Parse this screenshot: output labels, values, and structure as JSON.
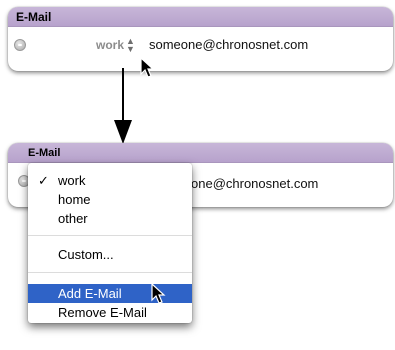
{
  "top_panel": {
    "title": "E-Mail",
    "field_label": "work",
    "field_value": "someone@chronosnet.com"
  },
  "bottom_panel": {
    "title": "E-Mail",
    "field_value_visible": "one@chronosnet.com",
    "field_value_full": "someone@chronosnet.com"
  },
  "menu": {
    "selected": "work",
    "group1": [
      "work",
      "home",
      "other"
    ],
    "custom_label": "Custom...",
    "group3": [
      "Add E-Mail",
      "Remove E-Mail"
    ],
    "highlighted": "Add E-Mail"
  },
  "colors": {
    "header": "#bda9d3",
    "highlight": "#2f63c7",
    "label_gray": "#8c8c8c"
  },
  "icons": {
    "remove_field": "minus-circle-icon",
    "label_popup": "up-down-arrows-icon",
    "check": "checkmark-icon",
    "pointer": "mouse-pointer-icon",
    "connector": "down-arrow-icon"
  }
}
